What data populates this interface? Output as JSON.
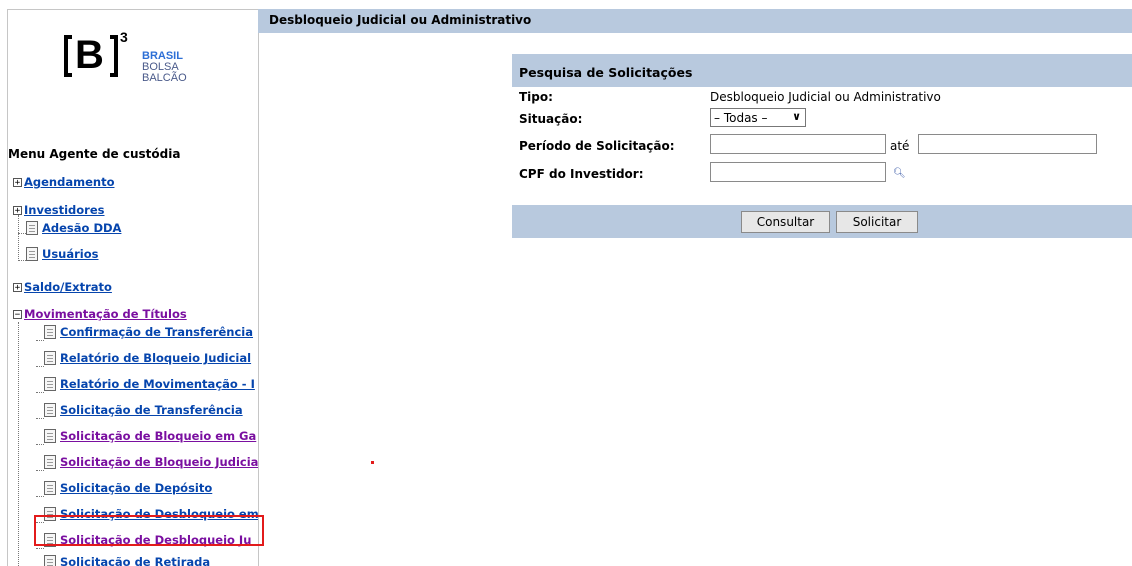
{
  "logo": {
    "mark": "B",
    "superscript": "3",
    "line1": "BRASIL",
    "line2": "BOLSA",
    "line3": "BALCÃO"
  },
  "menu": {
    "title": "Menu Agente de custódia",
    "items": [
      {
        "label": "Agendamento"
      },
      {
        "label": "Investidores"
      },
      {
        "label": "Adesão DDA"
      },
      {
        "label": "Usuários"
      },
      {
        "label": "Saldo/Extrato"
      },
      {
        "label": "Movimentação de Títulos"
      },
      {
        "label": "Confirmação de Transferência"
      },
      {
        "label": "Relatório de Bloqueio Judicial"
      },
      {
        "label": "Relatório de Movimentação - I"
      },
      {
        "label": "Solicitação de Transferência"
      },
      {
        "label": "Solicitação de Bloqueio em Ga"
      },
      {
        "label": "Solicitação de Bloqueio Judicia"
      },
      {
        "label": "Solicitação de Depósito"
      },
      {
        "label": "Solicitação de Desbloqueio em"
      },
      {
        "label": "Solicitação de Desbloqueio Ju"
      },
      {
        "label": "Solicitação de Retirada"
      }
    ]
  },
  "page_title": "Desbloqueio Judicial ou Administrativo",
  "form": {
    "header": "Pesquisa de Solicitações",
    "tipo_label": "Tipo:",
    "tipo_value": "Desbloqueio Judicial ou Administrativo",
    "situacao_label": "Situação:",
    "situacao_value": "– Todas –",
    "periodo_label": "Período de Solicitação:",
    "periodo_from": "",
    "ate_label": "até",
    "periodo_to": "",
    "cpf_label": "CPF do Investidor:",
    "cpf_value": "",
    "consultar": "Consultar",
    "solicitar": "Solicitar"
  },
  "colors": {
    "header_bg": "#b8c9de",
    "link": "#0645ad",
    "visited_link": "#7a0fa0",
    "highlight": "#e21b1b"
  }
}
